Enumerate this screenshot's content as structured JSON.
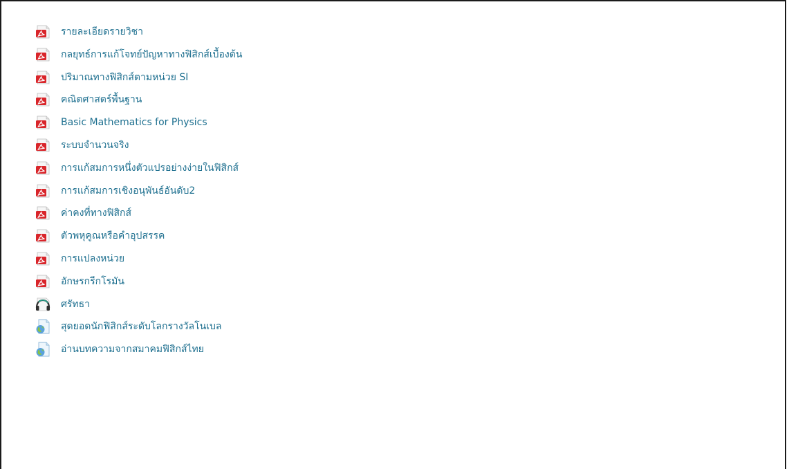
{
  "resources": [
    {
      "label": "รายละเอียดรายวิชา",
      "icon": "pdf-icon"
    },
    {
      "label": "กลยุทธ์การแก้โจทย์ปัญหาทางฟิสิกส์เบื้องต้น",
      "icon": "pdf-icon"
    },
    {
      "label": "ปริมาณทางฟิสิกส์ตามหน่วย SI",
      "icon": "pdf-icon"
    },
    {
      "label": "คณิตศาสตร์พื้นฐาน",
      "icon": "pdf-icon"
    },
    {
      "label": "Basic Mathematics for Physics",
      "icon": "pdf-icon"
    },
    {
      "label": "ระบบจำนวนจริง",
      "icon": "pdf-icon"
    },
    {
      "label": "การแก้สมการหนึ่งตัวแปรอย่างง่ายในฟิสิกส์",
      "icon": "pdf-icon"
    },
    {
      "label": "การแก้สมการเชิงอนุพันธ์อันดับ2",
      "icon": "pdf-icon"
    },
    {
      "label": "ค่าคงที่ทางฟิสิกส์",
      "icon": "pdf-icon"
    },
    {
      "label": "ตัวพหุคูณหรือคำอุปสรรค",
      "icon": "pdf-icon"
    },
    {
      "label": "การแปลงหน่วย",
      "icon": "pdf-icon"
    },
    {
      "label": "อักษรกรีกโรมัน",
      "icon": "pdf-icon"
    },
    {
      "label": "ศรัทธา",
      "icon": "audio-icon"
    },
    {
      "label": "สุดยอดนักฟิสิกส์ระดับโลกรางวัลโนเบล",
      "icon": "web-page-icon"
    },
    {
      "label": "อ่านบทความจากสมาคมฟิสิกส์ไทย",
      "icon": "web-page-icon"
    }
  ],
  "colors": {
    "link": "#1d6f8f",
    "pdf_red": "#d9252a",
    "border": "#1a1a1a"
  }
}
